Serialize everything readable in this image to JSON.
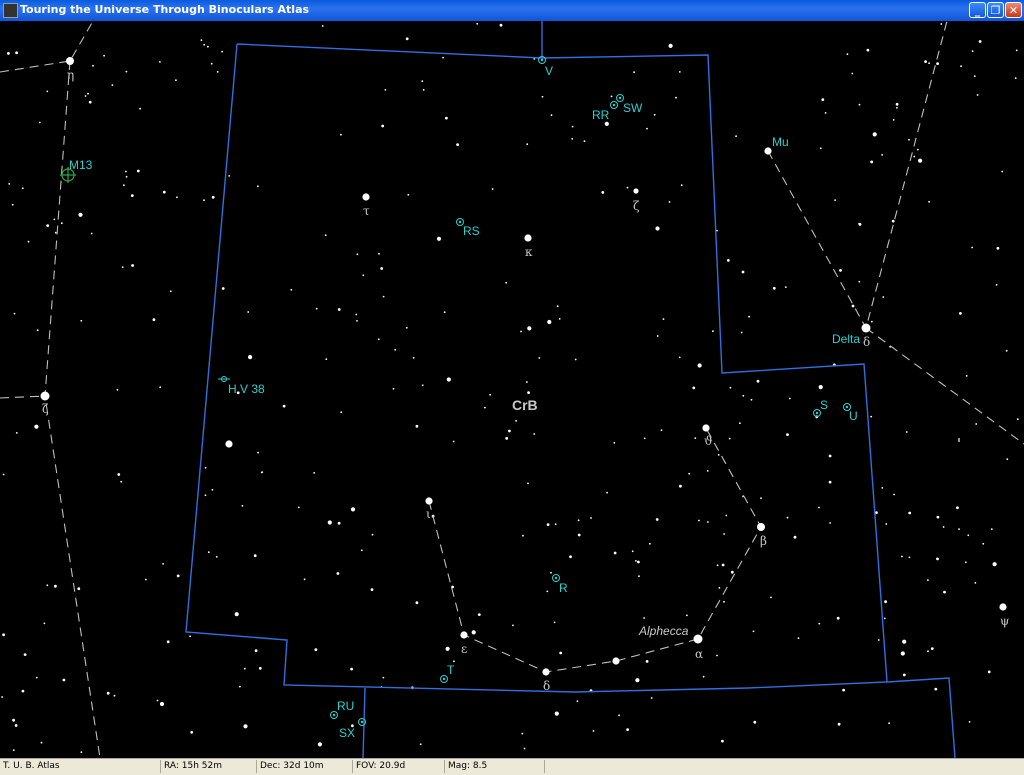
{
  "window": {
    "title": "Touring the Universe Through Binoculars Atlas",
    "buttons": {
      "minimize": "_",
      "restore": "❐",
      "close": "✕"
    }
  },
  "constellation": {
    "name": "CrB"
  },
  "labels": {
    "tau": "τ",
    "kappa": "κ",
    "zeta_crb": "ζ",
    "theta": "ϑ",
    "beta": "β",
    "alpha": "α",
    "delta_crb": "δ",
    "epsilon": "ε",
    "iota": "ι",
    "eta_her": "η",
    "zeta_her": "ζ",
    "delta_ser": "δ",
    "psi": "ψ",
    "alphecca": "Alphecca"
  },
  "objects": {
    "v": "V",
    "rr": "RR",
    "sw": "SW",
    "rs": "RS",
    "s": "S",
    "u": "U",
    "r": "R",
    "t": "T",
    "ru": "RU",
    "sx": "SX",
    "mu": "Mu",
    "delta": "Delta",
    "hv38": "H V 38",
    "m13": "M13"
  },
  "status": {
    "app": "T. U. B. Atlas",
    "ra": "RA: 15h 52m",
    "dec": "Dec: 32d 10m",
    "fov": "FOV: 20.9d",
    "mag": "Mag: 8.5"
  },
  "colors": {
    "background": "#000000",
    "boundary": "#2f6fe0",
    "object_label": "#2ad0d0",
    "greek_label": "#c8c8c8",
    "star": "#ffffff",
    "figure_line": "#bfbfbf",
    "cluster": "#2ea84a"
  }
}
